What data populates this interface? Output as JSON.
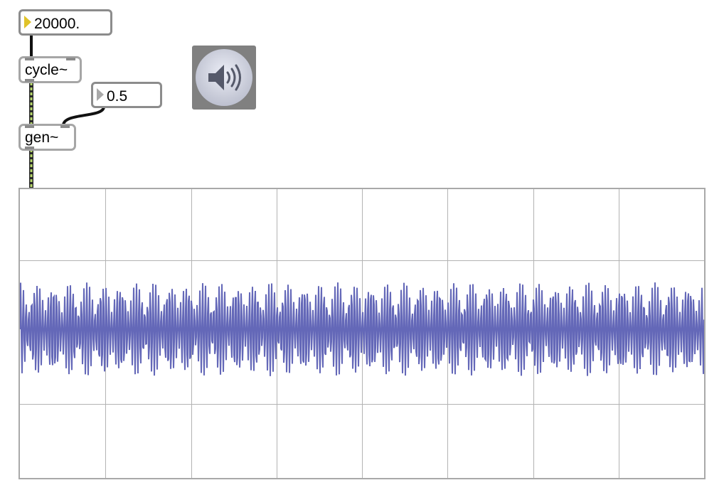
{
  "patch": {
    "freq_number": {
      "value": "20000."
    },
    "cycle_object": {
      "label": "cycle~"
    },
    "param_number": {
      "value": "0.5"
    },
    "gen_object": {
      "label": "gen~"
    },
    "dac_toggle": {
      "icon": "speaker-icon"
    },
    "scope": {
      "grid_columns": 8,
      "grid_rows": 4,
      "wave_color": "#6468b8",
      "grid_color": "#b3b3b3"
    }
  },
  "colors": {
    "number_arrow": "#e0c32a",
    "signal_patchcord": "#b5d66a",
    "control_patchcord": "#111111"
  }
}
